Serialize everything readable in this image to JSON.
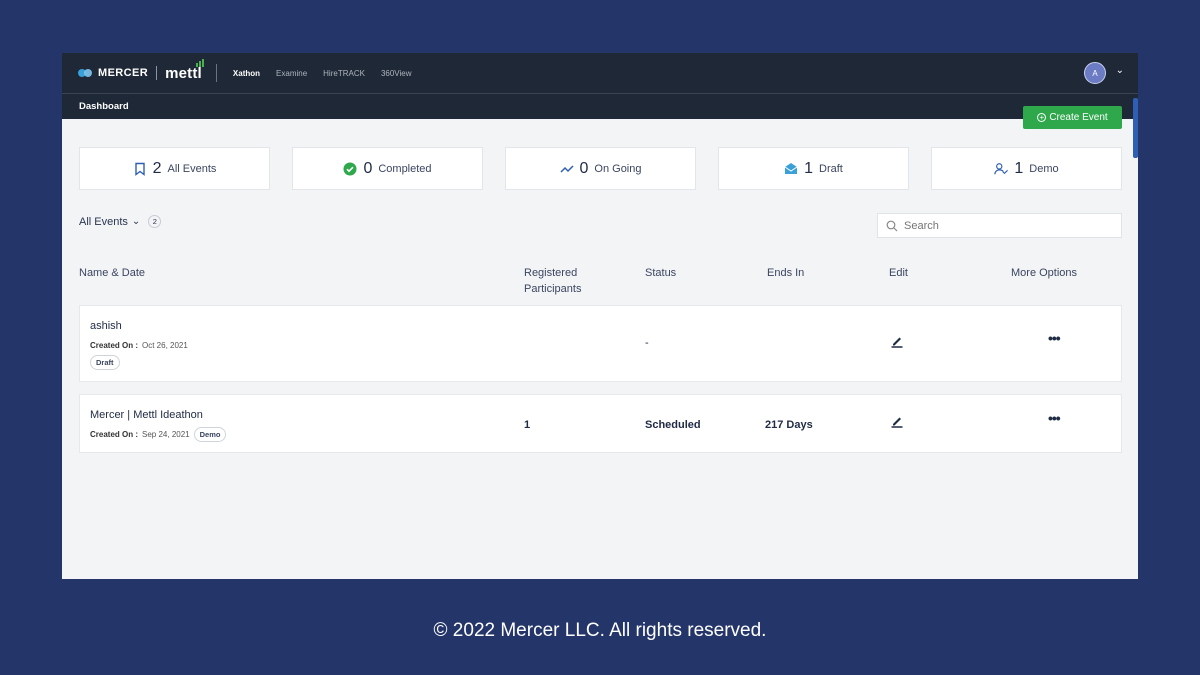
{
  "brand": {
    "mercer": "MERCER",
    "mettl": "mettl"
  },
  "nav": [
    "Xathon",
    "Examine",
    "HireTRACK",
    "360View"
  ],
  "user": {
    "initial": "A"
  },
  "subnav": {
    "title": "Dashboard"
  },
  "create_button": {
    "label": "Create Event"
  },
  "stats": [
    {
      "icon": "bookmark-icon",
      "count": "2",
      "label": "All Events",
      "color": "#2e5fb5"
    },
    {
      "icon": "check-circle-icon",
      "count": "0",
      "label": "Completed",
      "color": "#2ea84b"
    },
    {
      "icon": "trend-icon",
      "count": "0",
      "label": "On Going",
      "color": "#2e5fb5"
    },
    {
      "icon": "envelope-icon",
      "count": "1",
      "label": "Draft",
      "color": "#3aa0d8"
    },
    {
      "icon": "user-check-icon",
      "count": "1",
      "label": "Demo",
      "color": "#2e5fb5"
    }
  ],
  "filter": {
    "label": "All Events",
    "count": "2"
  },
  "search": {
    "placeholder": "Search"
  },
  "table": {
    "headers": {
      "name_date": "Name & Date",
      "registered_1": "Registered",
      "registered_2": "Participants",
      "status": "Status",
      "ends_in": "Ends In",
      "edit": "Edit",
      "more": "More Options"
    },
    "rows": [
      {
        "name": "ashish",
        "created_label": "Created On :",
        "created_date": "Oct 26, 2021",
        "tag": "Draft",
        "participants": "",
        "status": "-",
        "ends_in": ""
      },
      {
        "name": "Mercer | Mettl Ideathon",
        "created_label": "Created On :",
        "created_date": "Sep 24, 2021",
        "tag": "Demo",
        "participants": "1",
        "status": "Scheduled",
        "ends_in": "217 Days"
      }
    ]
  },
  "footer": "© 2022 Mercer LLC. All rights reserved."
}
